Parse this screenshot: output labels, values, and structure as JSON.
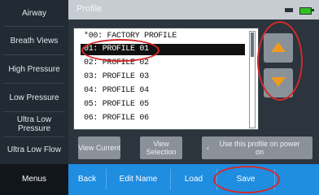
{
  "sidebar": {
    "items": [
      {
        "label": "Airway"
      },
      {
        "label": "Breath Views"
      },
      {
        "label": "High Pressure"
      },
      {
        "label": "Low Pressure"
      },
      {
        "label": "Ultra Low Pressure"
      },
      {
        "label": "Ultra Low Flow"
      }
    ],
    "menu_label": "Menus"
  },
  "title_bar": {
    "title": "Profile"
  },
  "profile_list": {
    "items": [
      {
        "label": "*00: FACTORY PROFILE",
        "selected": false
      },
      {
        "label": "01: PROFILE 01",
        "selected": true
      },
      {
        "label": "02: PROFILE 02",
        "selected": false
      },
      {
        "label": "03: PROFILE 03",
        "selected": false
      },
      {
        "label": "04: PROFILE 04",
        "selected": false
      },
      {
        "label": "05: PROFILE 05",
        "selected": false
      },
      {
        "label": "06: PROFILE 06",
        "selected": false
      }
    ]
  },
  "actions": {
    "view_current": "View Current",
    "view_selection": "View Selection",
    "use_profile": "Use this profile on power on"
  },
  "bottom_bar": {
    "back": "Back",
    "edit_name": "Edit Name",
    "load": "Load",
    "save": "Save"
  },
  "colors": {
    "accent_orange": "#f09a1e",
    "bottom_bar_blue": "#1f8de0",
    "annotation_red": "#d42a2a"
  },
  "icons": {
    "up": "triangle-up-icon",
    "down": "triangle-down-icon",
    "battery": "battery-icon",
    "power": "plug-icon"
  }
}
